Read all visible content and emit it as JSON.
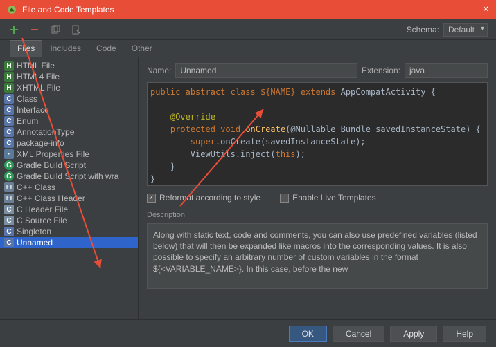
{
  "title": "File and Code Templates",
  "toolbar": {
    "schema_label": "Schema:",
    "schema_value": "Default"
  },
  "tabs": [
    {
      "label": "Files",
      "active": true
    },
    {
      "label": "Includes",
      "active": false
    },
    {
      "label": "Code",
      "active": false
    },
    {
      "label": "Other",
      "active": false
    }
  ],
  "files": [
    {
      "label": "HTML File",
      "icon": "html"
    },
    {
      "label": "HTML4 File",
      "icon": "html"
    },
    {
      "label": "XHTML File",
      "icon": "html"
    },
    {
      "label": "Class",
      "icon": "class"
    },
    {
      "label": "Interface",
      "icon": "class"
    },
    {
      "label": "Enum",
      "icon": "class"
    },
    {
      "label": "AnnotationType",
      "icon": "class"
    },
    {
      "label": "package-info",
      "icon": "class"
    },
    {
      "label": "XML Properties File",
      "icon": "generic"
    },
    {
      "label": "Gradle Build Script",
      "icon": "gradle"
    },
    {
      "label": "Gradle Build Script with wra",
      "icon": "gradle"
    },
    {
      "label": "C++ Class",
      "icon": "cpp"
    },
    {
      "label": "C++ Class Header",
      "icon": "cpp"
    },
    {
      "label": "C Header File",
      "icon": "c"
    },
    {
      "label": "C Source File",
      "icon": "c"
    },
    {
      "label": "Singleton",
      "icon": "class"
    },
    {
      "label": "Unnamed",
      "icon": "class",
      "selected": true
    }
  ],
  "name_field": {
    "label": "Name:",
    "value": "Unnamed"
  },
  "ext_field": {
    "label": "Extension:",
    "value": "java"
  },
  "code": {
    "line1_public": "public",
    "line1_abstract": "abstract",
    "line1_class": "class",
    "line1_name": "${NAME}",
    "line1_extends": "extends",
    "line1_super": "AppCompatActivity",
    "override": "@Override",
    "protected": "protected",
    "void": "void",
    "onCreate": "onCreate",
    "params": "(@Nullable Bundle savedInstanceState)",
    "super_call_kw": "super",
    "super_call": ".onCreate(savedInstanceState);",
    "viewutils": "ViewUtils",
    "inject": ".inject(",
    "this": "this",
    "inject_end": ");"
  },
  "checks": {
    "reformat": "Reformat according to style",
    "live": "Enable Live Templates"
  },
  "description_label": "Description",
  "description": "Along with static text, code and comments, you can also use predefined variables (listed below) that will then be expanded like macros into the corresponding values.\nIt is also possible to specify an arbitrary number of custom variables in the format ${<VARIABLE_NAME>}. In this case, before the new",
  "buttons": {
    "ok": "OK",
    "cancel": "Cancel",
    "apply": "Apply",
    "help": "Help"
  }
}
